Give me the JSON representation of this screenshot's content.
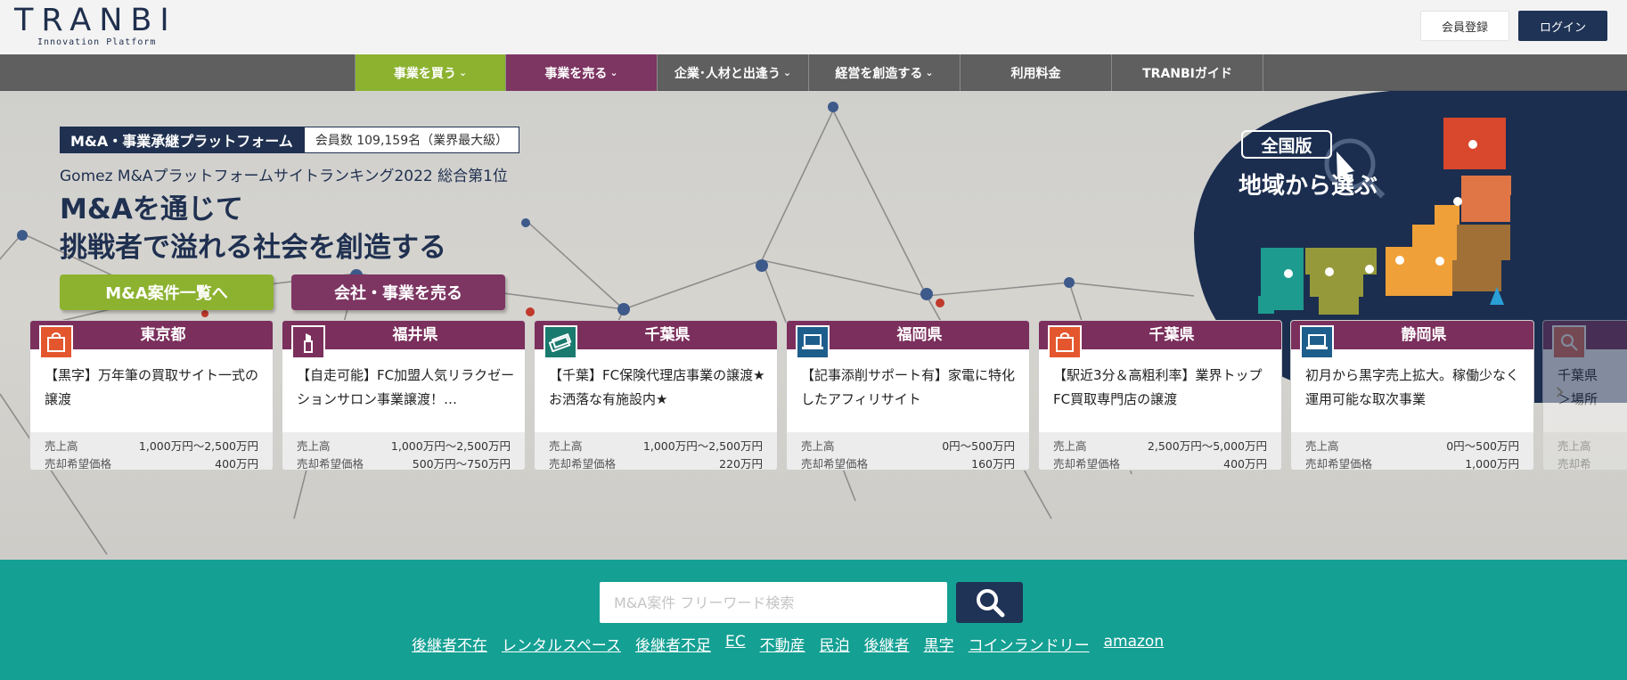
{
  "header": {
    "logo_main": "TRANBI",
    "logo_sub": "Innovation Platform",
    "register_label": "会員登録",
    "login_label": "ログイン"
  },
  "nav": {
    "items": [
      {
        "label": "事業を買う",
        "dropdown": true,
        "bg": "#8cb22f"
      },
      {
        "label": "事業を売る",
        "dropdown": true,
        "bg": "#7d3562"
      },
      {
        "label": "企業･人材と出逢う",
        "dropdown": true,
        "bg": "#5f5f5f"
      },
      {
        "label": "経営を創造する",
        "dropdown": true,
        "bg": "#5f5f5f"
      },
      {
        "label": "利用料金",
        "dropdown": false,
        "bg": "#5f5f5f"
      },
      {
        "label": "TRANBIガイド",
        "dropdown": false,
        "bg": "#5f5f5f"
      }
    ]
  },
  "hero": {
    "badge_left": "M&A・事業承継プラットフォーム",
    "badge_right": "会員数 109,159名（業界最大級）",
    "ranking": "Gomez M&Aプラットフォームサイトランキング2022 総合第1位",
    "headline_1": "M&Aを通じて",
    "headline_2": "挑戦者で溢れる社会を創造する",
    "cta_buy": "M&A案件一覧へ",
    "cta_sell": "会社・事業を売る",
    "region_tag": "全国版",
    "region_title": "地域から選ぶ"
  },
  "cards": [
    {
      "prefecture": "東京都",
      "icon": "shopping-bag-icon",
      "icon_color": "#e4572e",
      "title": "【黒字】万年筆の買取サイト一式の譲渡",
      "sales_label": "売上高",
      "sales": "1,000万円～2,500万円",
      "price_label": "売却希望価格",
      "price": "400万円"
    },
    {
      "prefecture": "福井県",
      "icon": "lipstick-icon",
      "icon_color": "#7b2f5c",
      "title": "【自走可能】FC加盟人気リラクゼーションサロン事業譲渡！…",
      "sales_label": "売上高",
      "sales": "1,000万円～2,500万円",
      "price_label": "売却希望価格",
      "price": "500万円～750万円"
    },
    {
      "prefecture": "千葉県",
      "icon": "money-icon",
      "icon_color": "#1a7a6e",
      "title": "【千葉】FC保険代理店事業の譲渡★お洒落な有施設内★",
      "sales_label": "売上高",
      "sales": "1,000万円～2,500万円",
      "price_label": "売却希望価格",
      "price": "220万円"
    },
    {
      "prefecture": "福岡県",
      "icon": "laptop-icon",
      "icon_color": "#1e5e8c",
      "title": "【記事添削サポート有】家電に特化したアフィリサイト",
      "sales_label": "売上高",
      "sales": "0円～500万円",
      "price_label": "売却希望価格",
      "price": "160万円"
    },
    {
      "prefecture": "千葉県",
      "icon": "shopping-bag-icon",
      "icon_color": "#e4572e",
      "title": "【駅近3分＆高粗利率】業界トップFC買取専門店の譲渡",
      "sales_label": "売上高",
      "sales": "2,500万円～5,000万円",
      "price_label": "売却希望価格",
      "price": "400万円"
    },
    {
      "prefecture": "静岡県",
      "icon": "laptop-icon",
      "icon_color": "#1e5e8c",
      "title": "初月から黒字売上拡大。稼働少なく運用可能な取次事業",
      "sales_label": "売上高",
      "sales": "0円～500万円",
      "price_label": "売却希望価格",
      "price": "1,000万円"
    },
    {
      "prefecture": "",
      "icon": "search-icon",
      "icon_color": "#e26a5a",
      "title": "千葉県\n＞場所",
      "sales_label": "売上高",
      "sales": "",
      "price_label": "売却希",
      "price": ""
    }
  ],
  "search": {
    "placeholder": "M&A案件 フリーワード検索",
    "keywords": [
      "後継者不在",
      "レンタルスペース",
      "後継者不足",
      "EC",
      "不動産",
      "民泊",
      "後継者",
      "黒字",
      "コインランドリー",
      "amazon"
    ]
  },
  "colors": {
    "navy": "#1e3356",
    "green": "#8cb22f",
    "purple": "#7b2f5c",
    "teal": "#14a093"
  }
}
